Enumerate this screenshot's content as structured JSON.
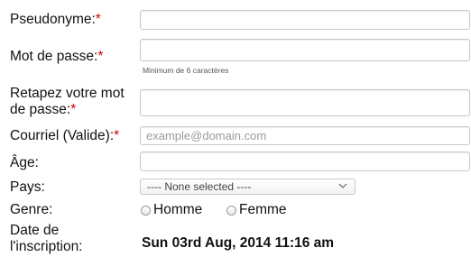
{
  "form": {
    "required_marker": "*",
    "username": {
      "label": "Pseudonyme:",
      "value": ""
    },
    "password": {
      "label": "Mot de passe:",
      "value": "",
      "hint": "Minimum de 6 caractères"
    },
    "password_confirm": {
      "label_line1": "Retapez votre mot",
      "label_line2": "de passe:",
      "value": ""
    },
    "email": {
      "label": "Courriel (Valide):",
      "placeholder": "example@domain.com",
      "value": ""
    },
    "age": {
      "label": "Âge:",
      "value": ""
    },
    "country": {
      "label": "Pays:",
      "selected": "---- None selected ----"
    },
    "gender": {
      "label": "Genre:",
      "options": [
        "Homme",
        "Femme"
      ],
      "selected": null
    },
    "registration_date": {
      "label_line1": "Date de",
      "label_line2": "l'inscription:",
      "value": "Sun 03rd Aug, 2014 11:16 am"
    }
  },
  "colors": {
    "required": "#cc0000",
    "border": "#c8c8c8",
    "placeholder": "#9a9a9a"
  },
  "icons": {
    "select_arrow": "chevron-down-icon"
  }
}
